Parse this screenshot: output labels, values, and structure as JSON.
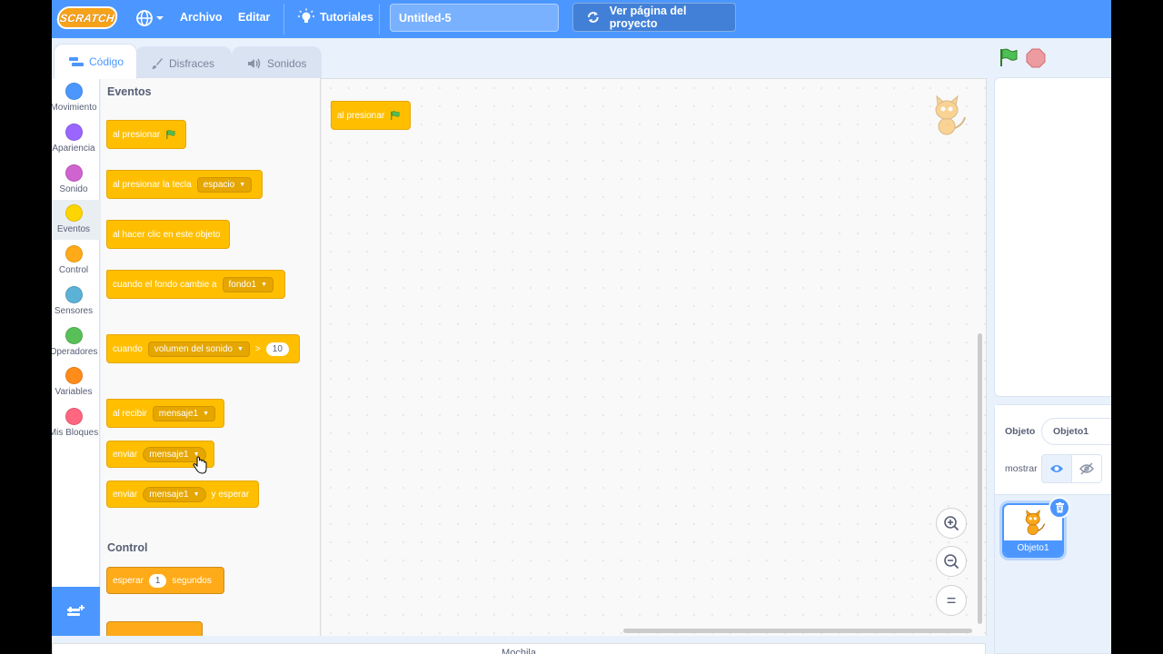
{
  "menubar": {
    "logo": "SCRATCH",
    "file": "Archivo",
    "edit": "Editar",
    "tutorials": "Tutoriales",
    "project_title": "Untitled-5",
    "see_project": "Ver página del proyecto"
  },
  "tabs": [
    {
      "label": "Código"
    },
    {
      "label": "Disfraces"
    },
    {
      "label": "Sonidos"
    }
  ],
  "categories": [
    {
      "label": "Movimiento",
      "color": "#4c97ff"
    },
    {
      "label": "Apariencia",
      "color": "#9966ff"
    },
    {
      "label": "Sonido",
      "color": "#cf63cf"
    },
    {
      "label": "Eventos",
      "color": "#ffd500"
    },
    {
      "label": "Control",
      "color": "#ffab19"
    },
    {
      "label": "Sensores",
      "color": "#5cb1d6"
    },
    {
      "label": "Operadores",
      "color": "#59c059"
    },
    {
      "label": "Variables",
      "color": "#ff8c1a"
    },
    {
      "label": "Mis Bloques",
      "color": "#ff6680"
    }
  ],
  "palette": {
    "events_title": "Eventos",
    "control_title": "Control",
    "blocks": {
      "when_flag": "al presionar",
      "when_key": "al presionar la tecla",
      "key_value": "espacio",
      "when_clicked": "al hacer clic en este objeto",
      "when_backdrop": "cuando el fondo cambie a",
      "backdrop_value": "fondo1",
      "when_greater": "cuando",
      "greater_value": "volumen del sonido",
      "greater_op": ">",
      "greater_num": "10",
      "when_receive": "al recibir",
      "receive_value": "mensaje1",
      "broadcast": "enviar",
      "broadcast_value": "mensaje1",
      "broadcast_wait": "enviar",
      "broadcast_wait_value": "mensaje1",
      "broadcast_wait_suffix": "y esperar",
      "wait": "esperar",
      "wait_num": "1",
      "wait_suffix": "segundos"
    }
  },
  "workspace": {
    "script_block": "al presionar"
  },
  "zoom": {
    "in_icon": "zoom-in-icon",
    "out_icon": "zoom-out-icon",
    "reset": "="
  },
  "backpack": "Mochila",
  "sprite_info": {
    "sprite_label": "Objeto",
    "sprite_name": "Objeto1",
    "show_label": "mostrar"
  },
  "sprite_list": [
    {
      "name": "Objeto1",
      "selected": true
    }
  ],
  "colors": {
    "accent": "#4c97ff",
    "events": "#ffbf00",
    "control": "#ffab19"
  }
}
